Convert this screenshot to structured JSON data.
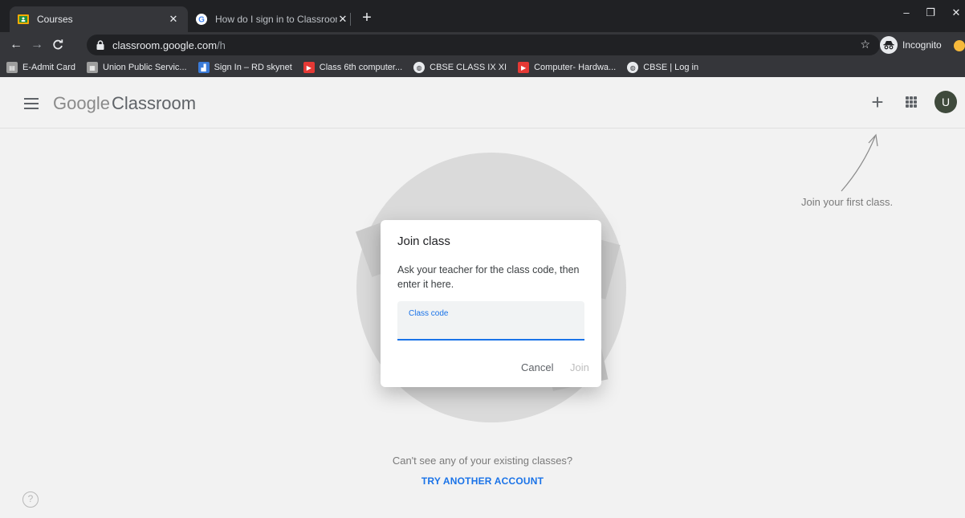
{
  "browser": {
    "tabs": [
      {
        "title": "Courses",
        "active": true
      },
      {
        "title": "How do I sign in to Classroom? -",
        "active": false
      }
    ],
    "new_tab_label": "+",
    "window_controls": {
      "minimize": "–",
      "restore": "❐",
      "close": "✕"
    },
    "url": {
      "domain": "classroom.google.com",
      "path": "/h"
    },
    "incognito_label": "Incognito",
    "bookmarks": [
      {
        "label": "E-Admit Card",
        "icon": "document-icon",
        "color": "#9e9e9e"
      },
      {
        "label": "Union Public Servic...",
        "icon": "building-icon",
        "color": "#9e9e9e"
      },
      {
        "label": "Sign In – RD skynet",
        "icon": "chart-icon",
        "color": "#3b7bd8"
      },
      {
        "label": "Class 6th computer...",
        "icon": "youtube-icon",
        "color": "#e53935"
      },
      {
        "label": "CBSE CLASS IX XI",
        "icon": "globe-icon",
        "color": "#e8eaed"
      },
      {
        "label": "Computer- Hardwa...",
        "icon": "youtube-icon",
        "color": "#e53935"
      },
      {
        "label": "CBSE | Log in",
        "icon": "globe-icon",
        "color": "#e8eaed"
      }
    ]
  },
  "app": {
    "brand_google": "Google",
    "brand_product": "Classroom",
    "avatar_letter": "U",
    "hint_text": "Join your first class.",
    "empty_message": "Can't see any of your existing classes?",
    "try_another": "TRY ANOTHER ACCOUNT",
    "help_glyph": "?"
  },
  "dialog": {
    "title": "Join class",
    "body": "Ask your teacher for the class code, then enter it here.",
    "field_label": "Class code",
    "field_value": "",
    "cancel_label": "Cancel",
    "join_label": "Join"
  },
  "colors": {
    "accent": "#1a73e8",
    "chrome_dark": "#202124",
    "chrome_toolbar": "#35363a"
  }
}
